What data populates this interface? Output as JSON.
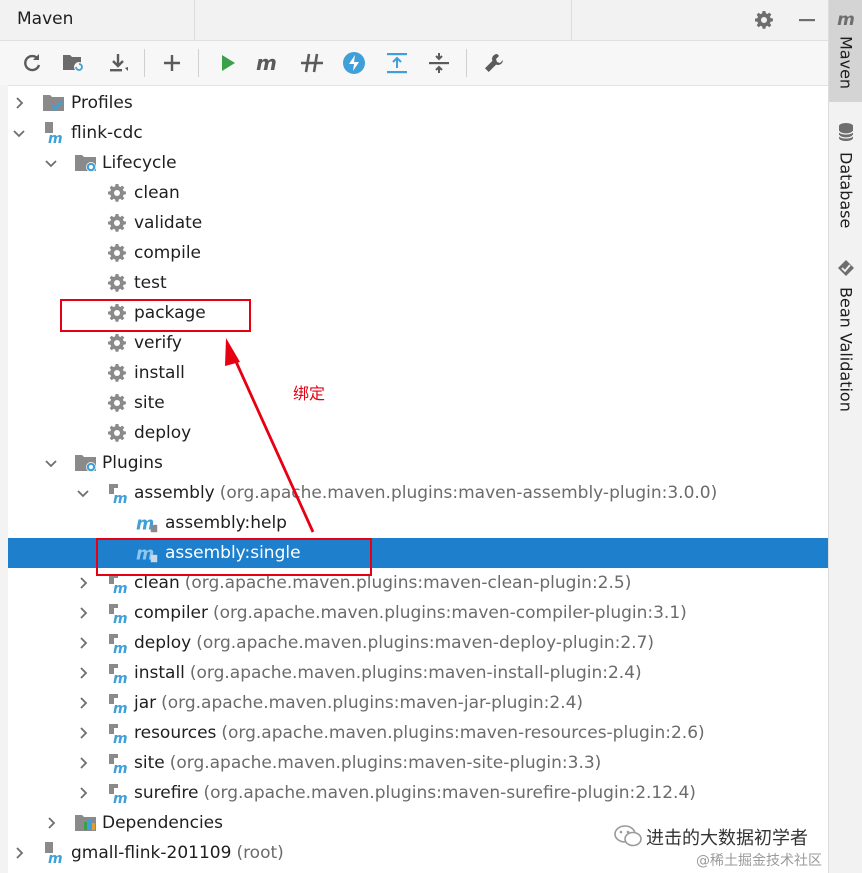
{
  "header": {
    "title": "Maven"
  },
  "colors": {
    "accent": "#1e7fcd",
    "run_green": "#3aa14a",
    "maven_blue": "#3f9fd9",
    "annotation_red": "#e60012"
  },
  "toolbar": {
    "buttons": [
      "reload-icon",
      "generate-sources-icon",
      "download-icon",
      "add-icon",
      "run-icon",
      "maven-m-icon",
      "toggle-offline-icon",
      "skip-tests-icon",
      "expand-all-icon",
      "collapse-all-icon",
      "settings-wrench-icon"
    ]
  },
  "tree": {
    "profiles": "Profiles",
    "project": "flink-cdc",
    "lifecycle": "Lifecycle",
    "lifecycle_items": [
      "clean",
      "validate",
      "compile",
      "test",
      "package",
      "verify",
      "install",
      "site",
      "deploy"
    ],
    "plugins": "Plugins",
    "assembly": {
      "name": "assembly",
      "detail": "(org.apache.maven.plugins:maven-assembly-plugin:3.0.0)"
    },
    "goals": [
      "assembly:help",
      "assembly:single"
    ],
    "other_plugins": [
      {
        "name": "clean",
        "detail": "(org.apache.maven.plugins:maven-clean-plugin:2.5)"
      },
      {
        "name": "compiler",
        "detail": "(org.apache.maven.plugins:maven-compiler-plugin:3.1)"
      },
      {
        "name": "deploy",
        "detail": "(org.apache.maven.plugins:maven-deploy-plugin:2.7)"
      },
      {
        "name": "install",
        "detail": "(org.apache.maven.plugins:maven-install-plugin:2.4)"
      },
      {
        "name": "jar",
        "detail": "(org.apache.maven.plugins:maven-jar-plugin:2.4)"
      },
      {
        "name": "resources",
        "detail": "(org.apache.maven.plugins:maven-resources-plugin:2.6)"
      },
      {
        "name": "site",
        "detail": "(org.apache.maven.plugins:maven-site-plugin:3.3)"
      },
      {
        "name": "surefire",
        "detail": "(org.apache.maven.plugins:maven-surefire-plugin:2.12.4)"
      }
    ],
    "dependencies": "Dependencies",
    "root_project": {
      "name": "gmall-flink-201109",
      "detail": "(root)"
    }
  },
  "side_tabs": [
    "Maven",
    "Database",
    "Bean Validation"
  ],
  "annotation": {
    "label": "绑定"
  },
  "watermark": {
    "line1": "进击的大数据初学者",
    "line2": "@稀土掘金技术社区"
  }
}
